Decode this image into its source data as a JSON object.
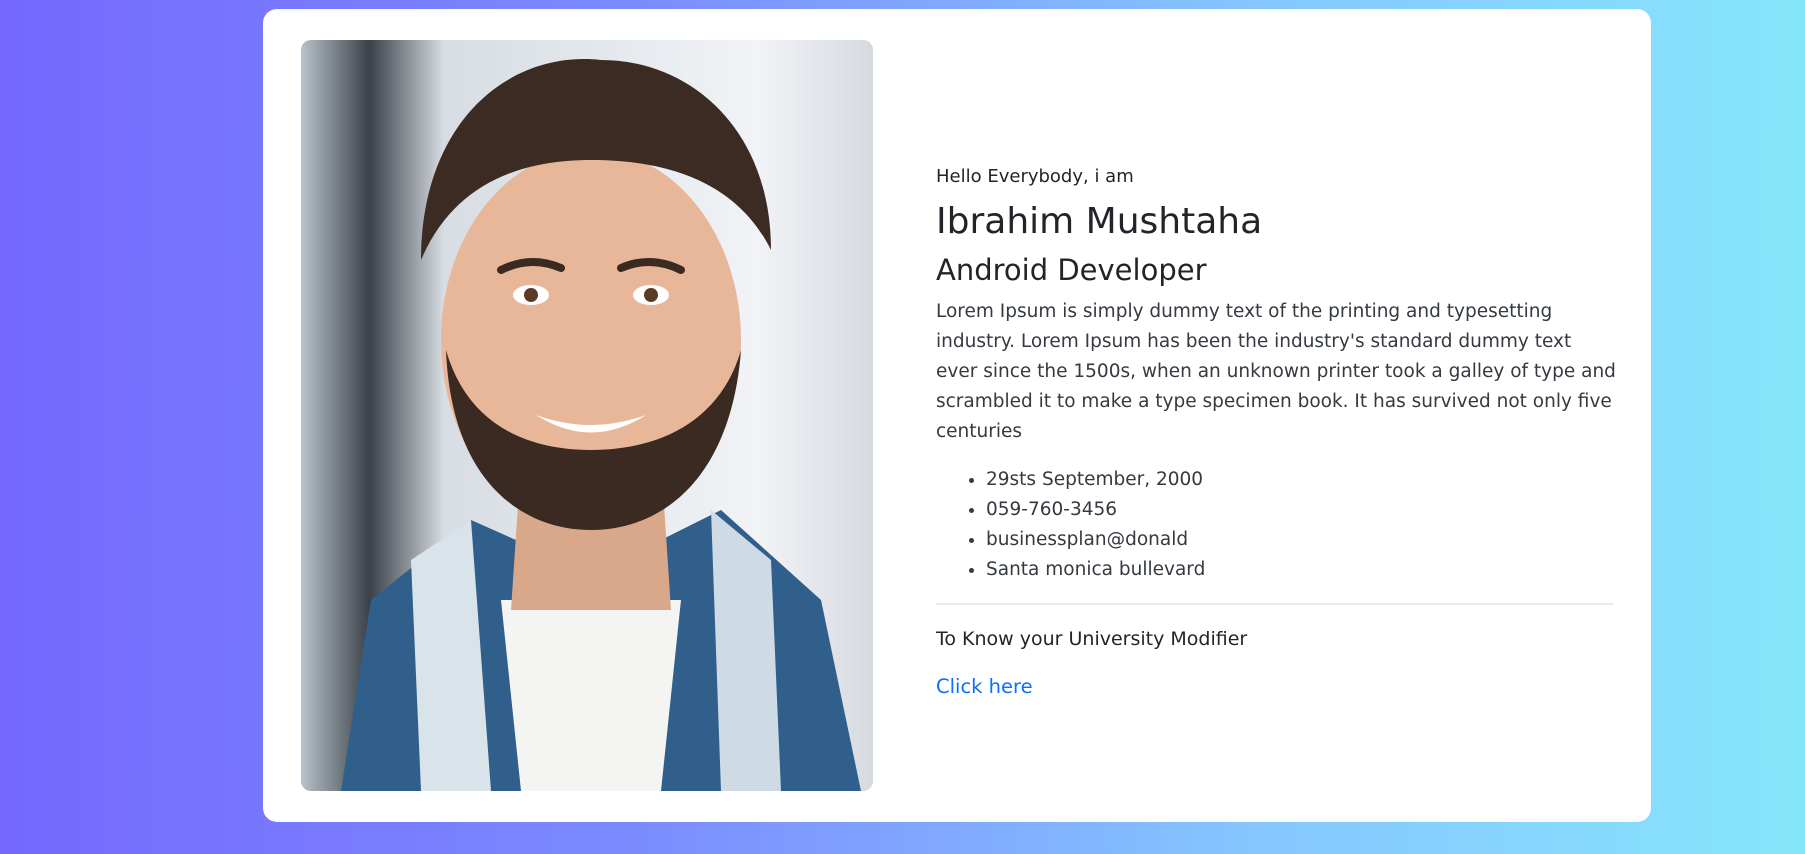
{
  "profile": {
    "photo_alt": "Portrait of a smiling man",
    "greeting": "Hello Everybody, i am",
    "name": "Ibrahim Mushtaha",
    "role": "Android Developer",
    "bio": "Lorem Ipsum is simply dummy text of the printing and typesetting industry. Lorem Ipsum has been the industry's standard dummy text ever since the 1500s, when an unknown printer took a galley of type and scrambled it to make a type specimen book. It has survived not only five centuries",
    "details": [
      "29sts September, 2000",
      "059-760-3456",
      "businessplan@donald",
      "Santa monica bullevard"
    ]
  },
  "cta": {
    "title": "To Know your University Modifier",
    "link_label": "Click here"
  },
  "colors": {
    "link": "#0d6efd",
    "gradient_start": "#7468ff",
    "gradient_end": "#86e6fb"
  }
}
